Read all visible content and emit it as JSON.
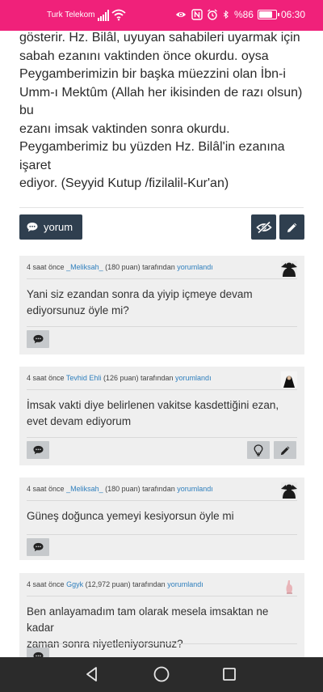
{
  "status_bar": {
    "carrier": "Turk Telekom",
    "battery_text": "%86",
    "battery_level": 0.86,
    "time": "06:30",
    "icons": [
      "signal-icon",
      "wifi-icon",
      "eye-icon",
      "nfc-icon",
      "alarm-icon",
      "bluetooth-icon",
      "battery-icon"
    ]
  },
  "article": {
    "text": "gösterir. Hz. Bilâl, uyuyan sahabileri uyarmak için\nsabah ezanını vaktinden önce okurdu. oysa\nPeygamberimizin bir başka müezzini olan İbn-i\nUmm-ı Mektûm (Allah her ikisinden de razı olsun) bu\nezanı imsak vaktinden sonra okurdu.\nPeygamberimiz bu yüzden Hz. Bilâl'in ezanına işaret\nediyor. (Seyyid Kutup /fizilalil-Kur'an)"
  },
  "actions": {
    "comment_label": "yorum",
    "icons": [
      "comment-icon",
      "hide-icon",
      "edit-icon"
    ]
  },
  "comments": [
    {
      "time": "4 saat önce",
      "user": "_Meliksah_",
      "points": "(180 puan)",
      "by": "tarafından",
      "action": "yorumlandı",
      "text": "Yani siz ezandan sonra da yiyip içmeye devam\nediyorsunuz öyle mi?"
    },
    {
      "time": "4 saat önce",
      "user": "Tevhid Ehli",
      "points": "(126 puan)",
      "by": "tarafından",
      "action": "yorumlandı",
      "text": "İmsak vakti diye belirlenen vakitse kasdettiğini ezan,\nevet devam ediyorum"
    },
    {
      "time": "4 saat önce",
      "user": "_Meliksah_",
      "points": "(180 puan)",
      "by": "tarafından",
      "action": "yorumlandı",
      "text": "Güneş doğunca yemeyi kesiyorsun öyle mi"
    },
    {
      "time": "4 saat önce",
      "user": "Ggyk",
      "points": "(12,972 puan)",
      "by": "tarafından",
      "action": "yorumlandı",
      "text": "Ben anlayamadım tam olarak mesela imsaktan ne kadar\nzaman sonra niyetleniyorsunuz?"
    }
  ],
  "colors": {
    "status_bar": "#f0217a",
    "button_dark": "#2f3f4f",
    "comment_bg": "#efefef",
    "link": "#2f7fbd",
    "nav_bar": "#2b2b2b"
  },
  "nav": {
    "icons": [
      "back-icon",
      "home-icon",
      "recents-icon"
    ]
  }
}
